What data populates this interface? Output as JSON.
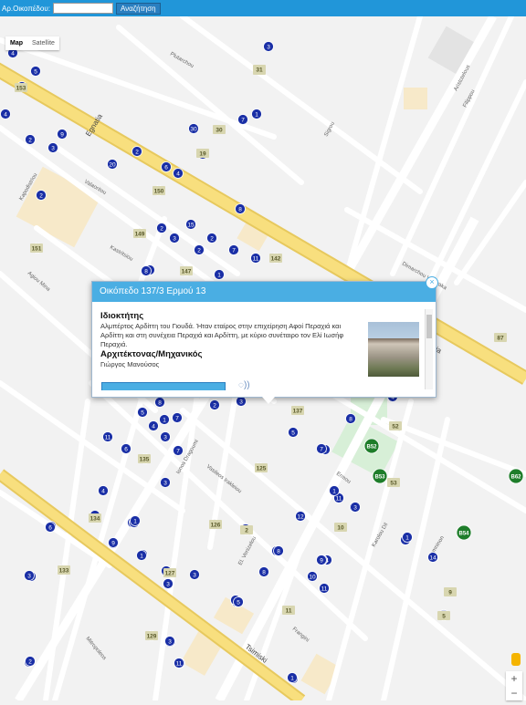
{
  "search": {
    "label": "Αρ.Οικοπέδου:",
    "value": "",
    "placeholder": "",
    "button_label": "Αναζήτηση"
  },
  "map_type": {
    "map_label": "Map",
    "satellite_label": "Satellite",
    "selected": "Map"
  },
  "zoom_controls": {
    "zoom_in": "+",
    "zoom_out": "−"
  },
  "streets": [
    {
      "name": "Egnatia",
      "label_type": "major"
    },
    {
      "name": "Tsimiski",
      "label_type": "major"
    },
    {
      "name": "El. Venizelou",
      "label_type": "minor"
    },
    {
      "name": "Ionos Dragoumi",
      "label_type": "minor"
    },
    {
      "name": "Ermou",
      "label_type": "minor"
    },
    {
      "name": "Vasileos Irakleiou",
      "label_type": "minor"
    },
    {
      "name": "Dimarchou Vamvaka",
      "label_type": "minor"
    },
    {
      "name": "Aristotelous",
      "label_type": "minor"
    },
    {
      "name": "Karolou Dil",
      "label_type": "minor"
    },
    {
      "name": "Plutarchou",
      "label_type": "minor"
    },
    {
      "name": "Kapodistriou",
      "label_type": "minor"
    },
    {
      "name": "Valaoritou",
      "label_type": "minor"
    },
    {
      "name": "Mitropoleos",
      "label_type": "minor"
    },
    {
      "name": "Komninon",
      "label_type": "minor"
    },
    {
      "name": "Frangini",
      "label_type": "minor"
    },
    {
      "name": "Egnatia",
      "label_type": "minor"
    },
    {
      "name": "Sigrou",
      "label_type": "minor"
    },
    {
      "name": "Kastritsiou",
      "label_type": "minor"
    },
    {
      "name": "Agiou Mina",
      "label_type": "minor"
    },
    {
      "name": "Filippou",
      "label_type": "minor"
    }
  ],
  "popup": {
    "title": "Οικόπεδο 137/3 Ερμού 13",
    "close": "×",
    "owner_heading": "Ιδιοκτήτης",
    "owner_text": "Αλμπέρτος Αρδίττη του Γιουδά. Ήταν εταίρος στην επιχείρηση Αφοί Περαχιά και Αρδίττη και στη συνέχεια Περαχιά και Αρδίττη, με κύριο συνέταιρο τον Ελί Ιωσήφ Περαχιά.",
    "architect_heading": "Αρχιτέκτονας/Μηχανικός",
    "architect_text": "Γιώργος Μανούσος"
  },
  "markers": {
    "blue": [
      "4",
      "5",
      "153",
      "9",
      "2",
      "3",
      "20",
      "6",
      "2",
      "4",
      "30",
      "19",
      "7",
      "6",
      "8",
      "11",
      "150",
      "2",
      "3",
      "15",
      "2",
      "2",
      "7",
      "8",
      "1",
      "149",
      "151",
      "147",
      "142",
      "3",
      "4",
      "1",
      "2",
      "5",
      "8",
      "2",
      "7",
      "3",
      "1",
      "11",
      "4",
      "3",
      "5",
      "3",
      "6",
      "2",
      "7",
      "1",
      "8",
      "12",
      "5",
      "4",
      "1",
      "11",
      "135",
      "4",
      "6",
      "9",
      "10",
      "3",
      "8",
      "4",
      "12",
      "1",
      "2",
      "125",
      "5",
      "7",
      "1",
      "3",
      "11",
      "1",
      "9",
      "2",
      "3",
      "8",
      "1",
      "10",
      "4",
      "11",
      "14",
      "1",
      "6",
      "5",
      "8",
      "11",
      "134",
      "1",
      "9",
      "1",
      "127",
      "133",
      "3",
      "2",
      "126",
      "1",
      "10",
      "2",
      "3",
      "11",
      "6",
      "5",
      "1",
      "3",
      "9",
      "129",
      "11",
      "3",
      "1",
      "3"
    ],
    "olive": [
      "31",
      "153",
      "30",
      "150",
      "149",
      "151",
      "147",
      "142",
      "137",
      "87",
      "52",
      "135",
      "125",
      "134",
      "126",
      "133",
      "127",
      "129",
      "53",
      "10",
      "11",
      "9",
      "31",
      "19",
      "5",
      "2"
    ],
    "green": [
      "B52",
      "B53",
      "B54",
      "B62"
    ]
  }
}
